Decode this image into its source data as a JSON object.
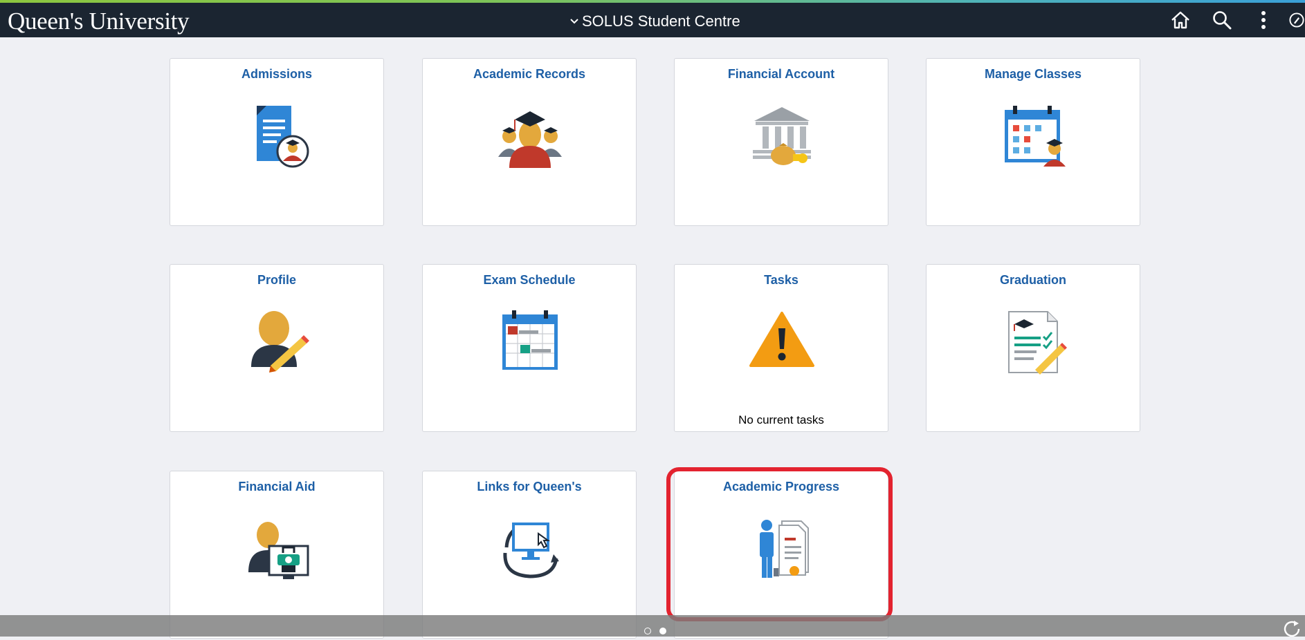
{
  "header": {
    "brand": "Queen's University",
    "title": "SOLUS Student Centre",
    "icons": [
      "home-icon",
      "search-icon",
      "more-options-icon",
      "navbar-icon"
    ]
  },
  "colors": {
    "header_bg": "#1b2531",
    "tile_title": "#1d5fa6",
    "highlight": "#e3232f",
    "page_bg": "#eff0f4"
  },
  "tiles": [
    {
      "title": "Admissions",
      "icon": "admissions-icon"
    },
    {
      "title": "Academic Records",
      "icon": "academic-records-icon"
    },
    {
      "title": "Financial Account",
      "icon": "financial-account-icon"
    },
    {
      "title": "Manage Classes",
      "icon": "manage-classes-icon"
    },
    {
      "title": "Profile",
      "icon": "profile-icon"
    },
    {
      "title": "Exam Schedule",
      "icon": "exam-schedule-icon"
    },
    {
      "title": "Tasks",
      "icon": "warning-icon",
      "note": "No current tasks"
    },
    {
      "title": "Graduation",
      "icon": "graduation-icon"
    },
    {
      "title": "Financial Aid",
      "icon": "financial-aid-icon"
    },
    {
      "title": "Links for Queen's",
      "icon": "links-icon"
    },
    {
      "title": "Academic Progress",
      "icon": "academic-progress-icon"
    }
  ],
  "pager": {
    "total": 2,
    "current": 2
  },
  "footer": {
    "icons": [
      "refresh-icon"
    ]
  }
}
